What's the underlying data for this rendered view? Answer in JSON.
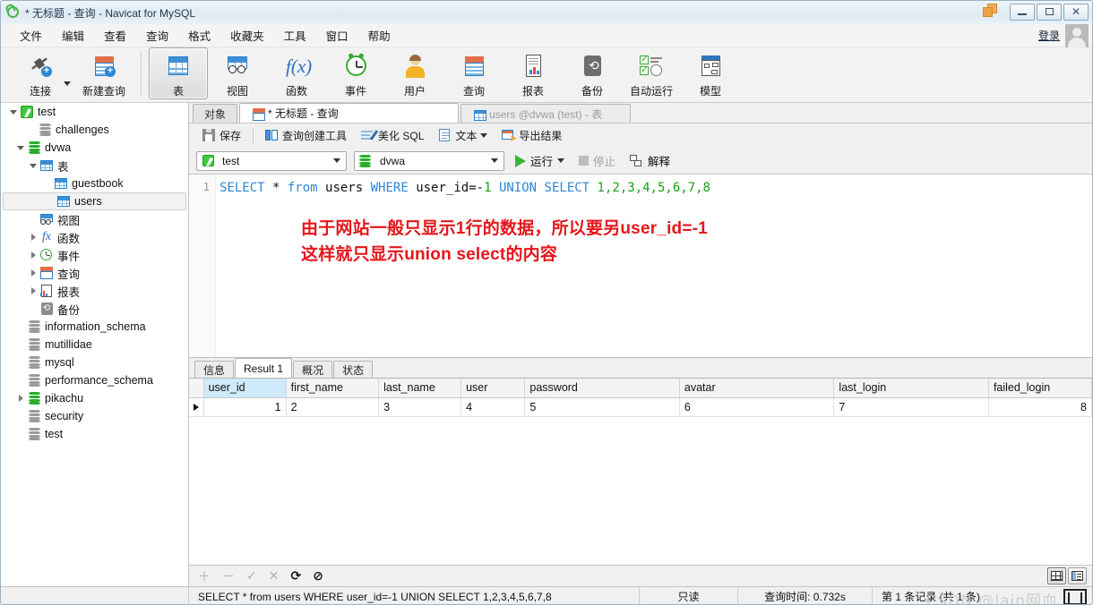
{
  "window": {
    "title": "* 无标题 - 查询 - Navicat for MySQL",
    "logo_icon": "navicat-logo-icon",
    "minimize_icon": "minimize-icon",
    "maximize_icon": "maximize-icon",
    "close_icon": "close-icon",
    "stack_icon": "window-stack-icon"
  },
  "menubar": {
    "items": [
      {
        "label": "文件"
      },
      {
        "label": "编辑"
      },
      {
        "label": "查看"
      },
      {
        "label": "查询"
      },
      {
        "label": "格式"
      },
      {
        "label": "收藏夹"
      },
      {
        "label": "工具"
      },
      {
        "label": "窗口"
      },
      {
        "label": "帮助"
      }
    ],
    "login_label": "登录",
    "avatar_icon": "user-avatar-icon"
  },
  "toolbar": {
    "items": [
      {
        "label": "连接",
        "icon": "connection-icon",
        "selected": false
      },
      {
        "label": "新建查询",
        "icon": "new-query-icon",
        "selected": false
      },
      {
        "label": "表",
        "icon": "table-icon",
        "selected": true
      },
      {
        "label": "视图",
        "icon": "view-icon",
        "selected": false
      },
      {
        "label": "函数",
        "icon": "function-icon",
        "selected": false
      },
      {
        "label": "事件",
        "icon": "event-icon",
        "selected": false
      },
      {
        "label": "用户",
        "icon": "user-icon",
        "selected": false
      },
      {
        "label": "查询",
        "icon": "query-icon",
        "selected": false
      },
      {
        "label": "报表",
        "icon": "report-icon",
        "selected": false
      },
      {
        "label": "备份",
        "icon": "backup-icon",
        "selected": false
      },
      {
        "label": "自动运行",
        "icon": "automation-icon",
        "selected": false
      },
      {
        "label": "模型",
        "icon": "model-icon",
        "selected": false
      }
    ]
  },
  "sidebar": {
    "items": [
      {
        "label": "test",
        "icon": "connection-icon",
        "indent": 0,
        "twisty": "open",
        "selected": false
      },
      {
        "label": "challenges",
        "icon": "database-icon",
        "indent": 1,
        "twisty": "none",
        "selected": false
      },
      {
        "label": "dvwa",
        "icon": "database-green-icon",
        "indent": 1,
        "twisty": "open",
        "selected": false
      },
      {
        "label": "表",
        "icon": "table-icon",
        "indent": 2,
        "twisty": "open",
        "selected": false
      },
      {
        "label": "guestbook",
        "icon": "table-icon",
        "indent": 3,
        "twisty": "none",
        "selected": false
      },
      {
        "label": "users",
        "icon": "table-icon",
        "indent": 3,
        "twisty": "none",
        "selected": true
      },
      {
        "label": "视图",
        "icon": "view-icon",
        "indent": 2,
        "twisty": "none",
        "selected": false
      },
      {
        "label": "函数",
        "icon": "function-icon",
        "indent": 2,
        "twisty": "closed",
        "selected": false
      },
      {
        "label": "事件",
        "icon": "event-icon",
        "indent": 2,
        "twisty": "closed",
        "selected": false
      },
      {
        "label": "查询",
        "icon": "query-icon",
        "indent": 2,
        "twisty": "closed",
        "selected": false
      },
      {
        "label": "报表",
        "icon": "report-icon",
        "indent": 2,
        "twisty": "closed",
        "selected": false
      },
      {
        "label": "备份",
        "icon": "backup-icon",
        "indent": 2,
        "twisty": "none",
        "selected": false
      },
      {
        "label": "information_schema",
        "icon": "database-icon",
        "indent": 1,
        "twisty": "none",
        "selected": false
      },
      {
        "label": "mutillidae",
        "icon": "database-icon",
        "indent": 1,
        "twisty": "none",
        "selected": false
      },
      {
        "label": "mysql",
        "icon": "database-icon",
        "indent": 1,
        "twisty": "none",
        "selected": false
      },
      {
        "label": "performance_schema",
        "icon": "database-icon",
        "indent": 1,
        "twisty": "none",
        "selected": false
      },
      {
        "label": "pikachu",
        "icon": "database-green-icon",
        "indent": 1,
        "twisty": "closed",
        "selected": false
      },
      {
        "label": "security",
        "icon": "database-icon",
        "indent": 1,
        "twisty": "none",
        "selected": false
      },
      {
        "label": "test",
        "icon": "database-icon",
        "indent": 1,
        "twisty": "none",
        "selected": false
      }
    ]
  },
  "object_tabs": [
    {
      "label": "对象",
      "icon": "none",
      "state": "inactive"
    },
    {
      "label": "* 无标题 - 查询",
      "icon": "query-icon",
      "state": "active"
    },
    {
      "label": "users @dvwa (test) - 表",
      "icon": "table-icon",
      "state": "dimmed"
    }
  ],
  "query_toolbar": {
    "save_label": "保存",
    "save_icon": "save-icon",
    "builder_label": "查询创建工具",
    "builder_icon": "query-builder-icon",
    "beautify_label": "美化 SQL",
    "beautify_icon": "beautify-sql-icon",
    "text_label": "文本",
    "text_icon": "text-icon",
    "text_caret_icon": "chevron-down-icon",
    "export_label": "导出结果",
    "export_icon": "export-results-icon"
  },
  "connection_bar": {
    "connection_value": "test",
    "connection_icon": "connection-icon",
    "connection_caret_icon": "chevron-down-icon",
    "database_value": "dvwa",
    "database_icon": "database-green-icon",
    "database_caret_icon": "chevron-down-icon",
    "run_label": "运行",
    "run_icon": "play-icon",
    "run_caret_icon": "chevron-down-icon",
    "stop_label": "停止",
    "stop_icon": "stop-icon",
    "explain_label": "解释",
    "explain_icon": "explain-icon"
  },
  "editor": {
    "line_number": "1",
    "sql_tokens": [
      {
        "t": "SELECT",
        "k": "kw"
      },
      {
        "t": " * ",
        "k": "op"
      },
      {
        "t": "from",
        "k": "kw"
      },
      {
        "t": " users ",
        "k": "op"
      },
      {
        "t": "WHERE",
        "k": "kw"
      },
      {
        "t": " user_id=-",
        "k": "op"
      },
      {
        "t": "1",
        "k": "num"
      },
      {
        "t": " ",
        "k": "op"
      },
      {
        "t": "UNION",
        "k": "kw"
      },
      {
        "t": " ",
        "k": "op"
      },
      {
        "t": "SELECT",
        "k": "kw"
      },
      {
        "t": " ",
        "k": "op"
      },
      {
        "t": "1,2,3,4,5,6,7,8",
        "k": "num"
      }
    ],
    "annotation_line1": "由于网站一般只显示1行的数据，所以要另user_id=-1",
    "annotation_line2": "这样就只显示union select的内容",
    "annotation_color": "#e5161b"
  },
  "result_tabs": [
    {
      "label": "信息",
      "active": false
    },
    {
      "label": "Result 1",
      "active": true
    },
    {
      "label": "概况",
      "active": false
    },
    {
      "label": "状态",
      "active": false
    }
  ],
  "result_grid": {
    "columns": [
      "user_id",
      "first_name",
      "last_name",
      "user",
      "password",
      "avatar",
      "last_login",
      "failed_login"
    ],
    "highlighted_column": "user_id",
    "rows": [
      {
        "values": [
          "1",
          "2",
          "3",
          "4",
          "5",
          "6",
          "7",
          "8"
        ],
        "current": true
      }
    ]
  },
  "nav_bar": {
    "add_icon": "plus-icon",
    "remove_icon": "minus-icon",
    "confirm_icon": "check-icon",
    "cancel_icon": "cross-icon",
    "refresh_icon": "refresh-icon",
    "stop_icon": "no-entry-icon",
    "grid_view_icon": "grid-view-icon",
    "form_view_icon": "form-view-icon"
  },
  "statusbar": {
    "sql_text": "SELECT * from users WHERE user_id=-1 UNION SELECT 1,2,3,4,5,6,7,8",
    "readonly_label": "只读",
    "query_time_label": "查询时间: 0.732s",
    "record_label": "第 1 条记录 (共 1 条)",
    "watermark": "CSDN @lain网血"
  }
}
